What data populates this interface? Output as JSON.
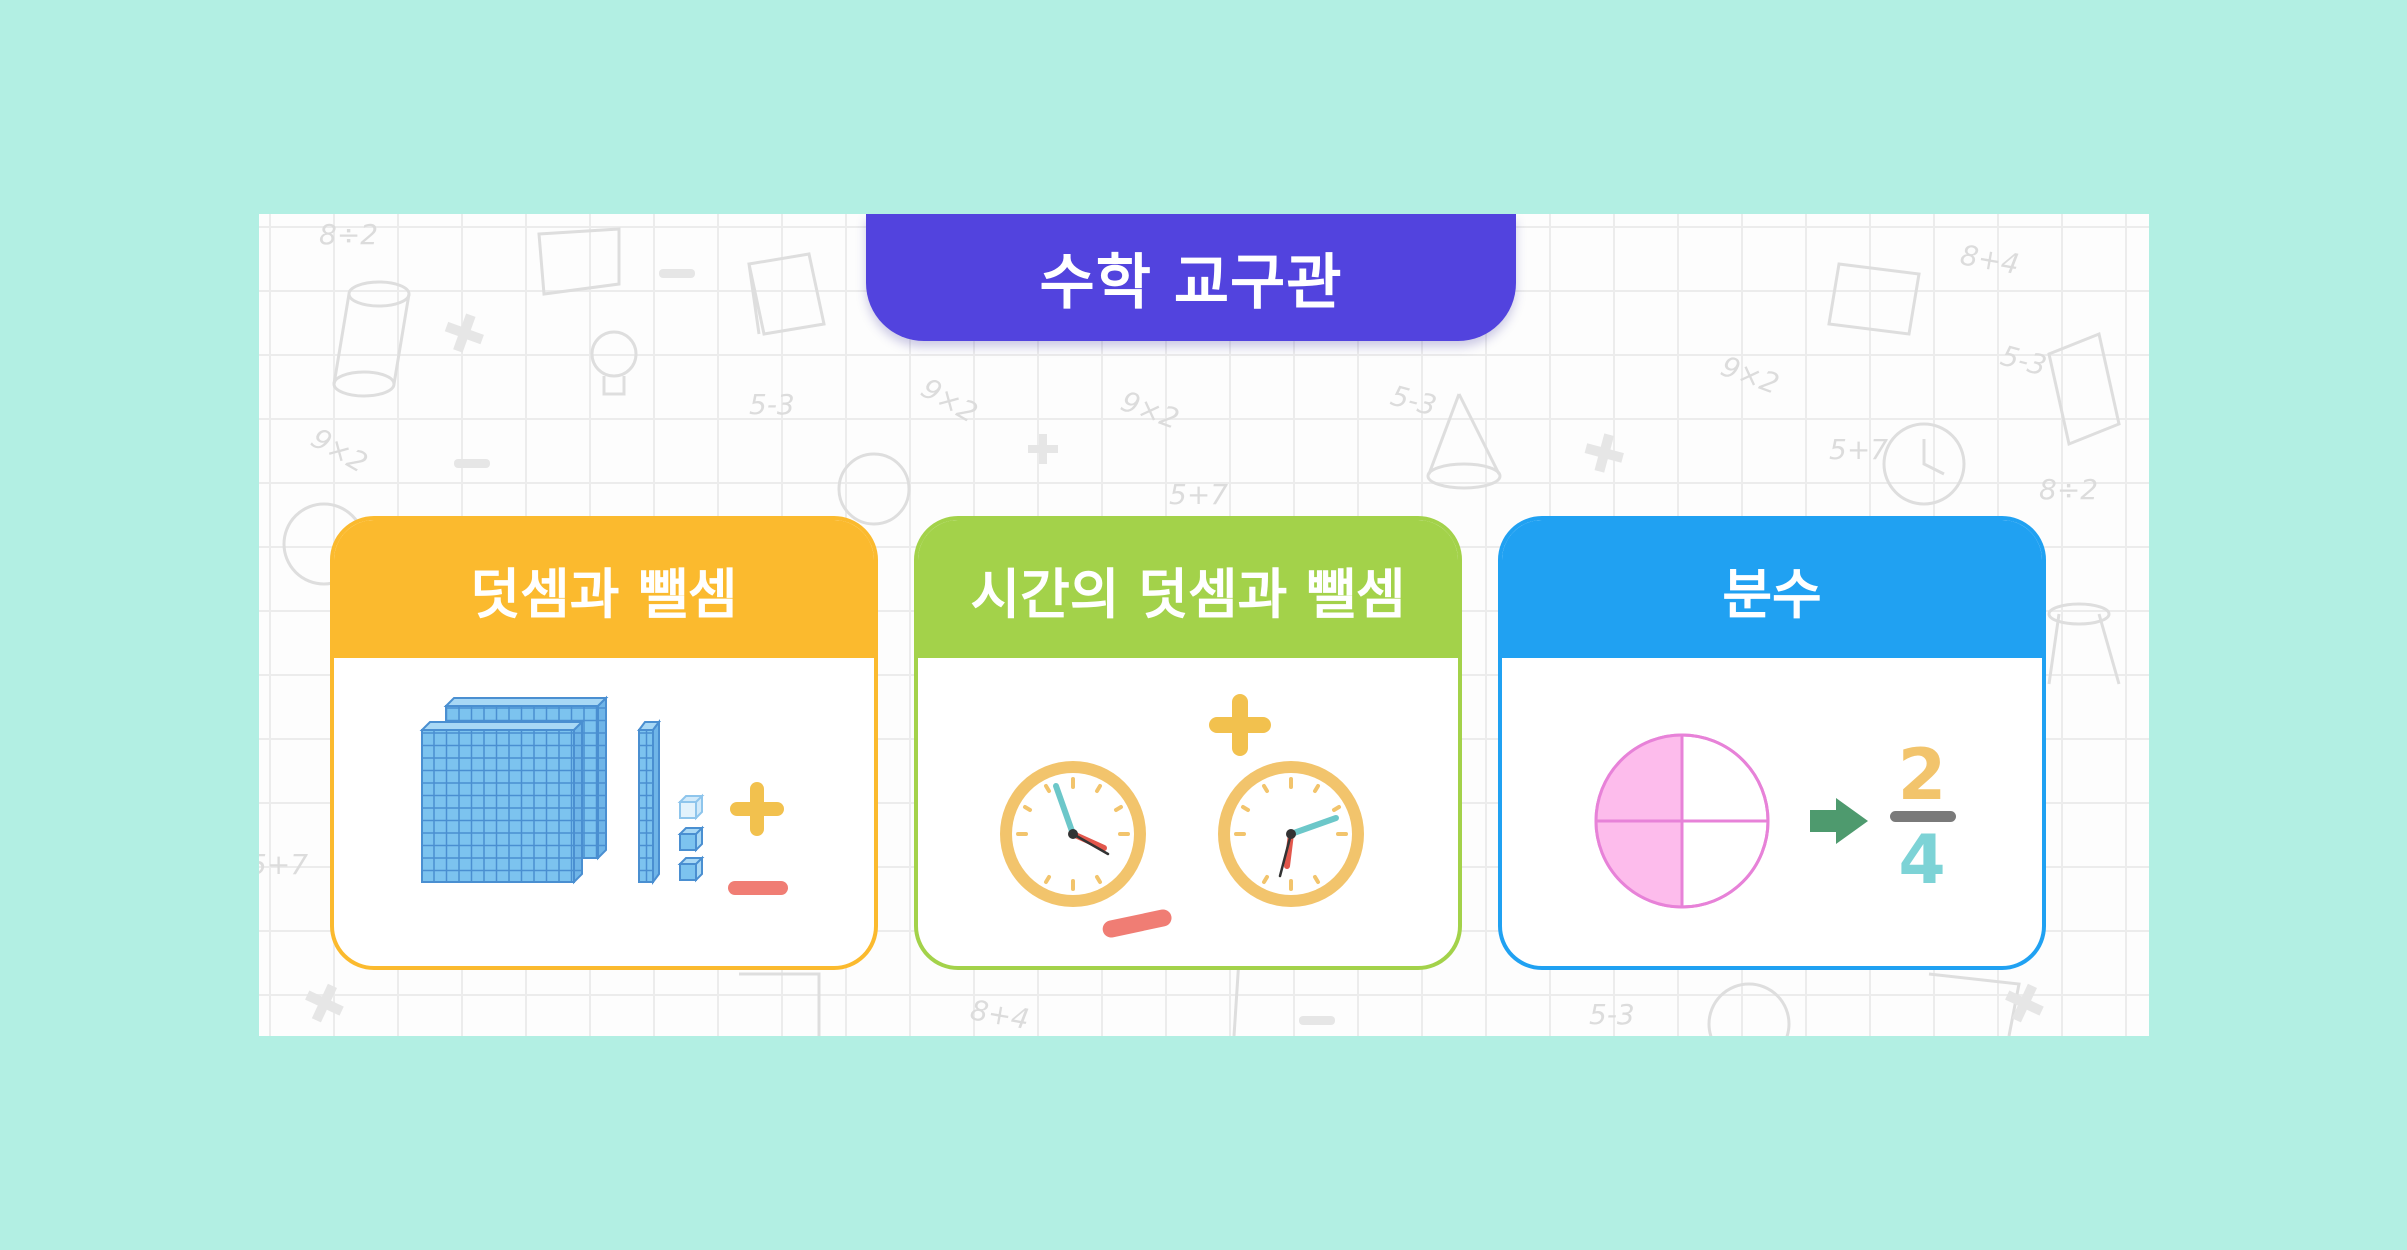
{
  "header": {
    "title": "수학 교구관"
  },
  "cards": [
    {
      "label": "덧셈과 뺄셈",
      "icon": "base-ten-blocks-icon",
      "color": "#fbba2e"
    },
    {
      "label": "시간의 덧셈과 뺄셈",
      "icon": "clocks-icon",
      "color": "#a3d24a"
    },
    {
      "label": "분수",
      "icon": "fraction-pie-icon",
      "color": "#20a1f2"
    }
  ],
  "fraction": {
    "numerator": "2",
    "denominator": "4"
  },
  "background_doodles": [
    "8÷2",
    "9×2",
    "5-3",
    "5+7",
    "8+4"
  ],
  "colors": {
    "page_bg": "#b2efe3",
    "title_bg": "#5243de",
    "plus": "#f2c14e",
    "minus": "#f07d74",
    "clock_rim": "#f2c46c",
    "fraction_fill": "#fdbcec",
    "arrow": "#4e9a6e"
  }
}
